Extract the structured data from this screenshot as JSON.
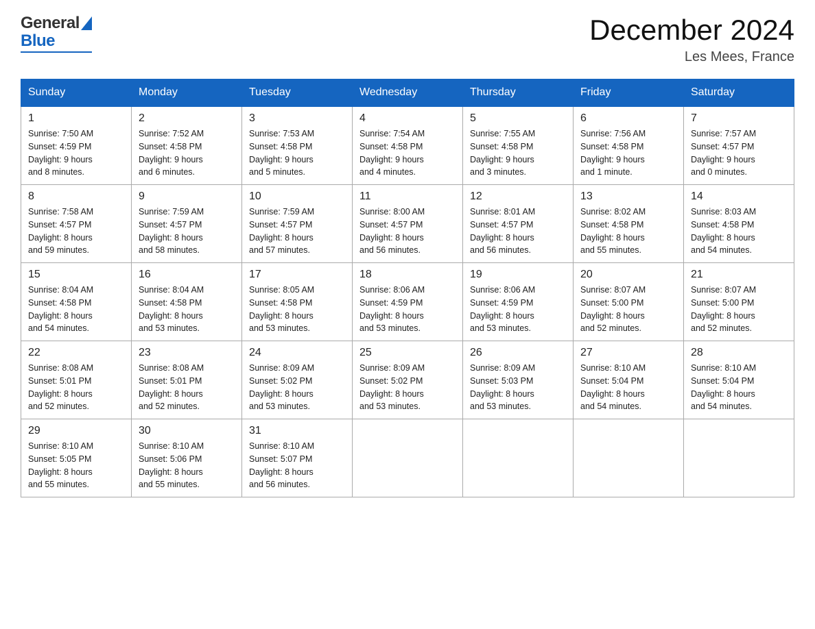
{
  "header": {
    "logo_general": "General",
    "logo_blue": "Blue",
    "title": "December 2024",
    "location": "Les Mees, France"
  },
  "columns": [
    "Sunday",
    "Monday",
    "Tuesday",
    "Wednesday",
    "Thursday",
    "Friday",
    "Saturday"
  ],
  "weeks": [
    [
      {
        "day": "1",
        "info": "Sunrise: 7:50 AM\nSunset: 4:59 PM\nDaylight: 9 hours\nand 8 minutes."
      },
      {
        "day": "2",
        "info": "Sunrise: 7:52 AM\nSunset: 4:58 PM\nDaylight: 9 hours\nand 6 minutes."
      },
      {
        "day": "3",
        "info": "Sunrise: 7:53 AM\nSunset: 4:58 PM\nDaylight: 9 hours\nand 5 minutes."
      },
      {
        "day": "4",
        "info": "Sunrise: 7:54 AM\nSunset: 4:58 PM\nDaylight: 9 hours\nand 4 minutes."
      },
      {
        "day": "5",
        "info": "Sunrise: 7:55 AM\nSunset: 4:58 PM\nDaylight: 9 hours\nand 3 minutes."
      },
      {
        "day": "6",
        "info": "Sunrise: 7:56 AM\nSunset: 4:58 PM\nDaylight: 9 hours\nand 1 minute."
      },
      {
        "day": "7",
        "info": "Sunrise: 7:57 AM\nSunset: 4:57 PM\nDaylight: 9 hours\nand 0 minutes."
      }
    ],
    [
      {
        "day": "8",
        "info": "Sunrise: 7:58 AM\nSunset: 4:57 PM\nDaylight: 8 hours\nand 59 minutes."
      },
      {
        "day": "9",
        "info": "Sunrise: 7:59 AM\nSunset: 4:57 PM\nDaylight: 8 hours\nand 58 minutes."
      },
      {
        "day": "10",
        "info": "Sunrise: 7:59 AM\nSunset: 4:57 PM\nDaylight: 8 hours\nand 57 minutes."
      },
      {
        "day": "11",
        "info": "Sunrise: 8:00 AM\nSunset: 4:57 PM\nDaylight: 8 hours\nand 56 minutes."
      },
      {
        "day": "12",
        "info": "Sunrise: 8:01 AM\nSunset: 4:57 PM\nDaylight: 8 hours\nand 56 minutes."
      },
      {
        "day": "13",
        "info": "Sunrise: 8:02 AM\nSunset: 4:58 PM\nDaylight: 8 hours\nand 55 minutes."
      },
      {
        "day": "14",
        "info": "Sunrise: 8:03 AM\nSunset: 4:58 PM\nDaylight: 8 hours\nand 54 minutes."
      }
    ],
    [
      {
        "day": "15",
        "info": "Sunrise: 8:04 AM\nSunset: 4:58 PM\nDaylight: 8 hours\nand 54 minutes."
      },
      {
        "day": "16",
        "info": "Sunrise: 8:04 AM\nSunset: 4:58 PM\nDaylight: 8 hours\nand 53 minutes."
      },
      {
        "day": "17",
        "info": "Sunrise: 8:05 AM\nSunset: 4:58 PM\nDaylight: 8 hours\nand 53 minutes."
      },
      {
        "day": "18",
        "info": "Sunrise: 8:06 AM\nSunset: 4:59 PM\nDaylight: 8 hours\nand 53 minutes."
      },
      {
        "day": "19",
        "info": "Sunrise: 8:06 AM\nSunset: 4:59 PM\nDaylight: 8 hours\nand 53 minutes."
      },
      {
        "day": "20",
        "info": "Sunrise: 8:07 AM\nSunset: 5:00 PM\nDaylight: 8 hours\nand 52 minutes."
      },
      {
        "day": "21",
        "info": "Sunrise: 8:07 AM\nSunset: 5:00 PM\nDaylight: 8 hours\nand 52 minutes."
      }
    ],
    [
      {
        "day": "22",
        "info": "Sunrise: 8:08 AM\nSunset: 5:01 PM\nDaylight: 8 hours\nand 52 minutes."
      },
      {
        "day": "23",
        "info": "Sunrise: 8:08 AM\nSunset: 5:01 PM\nDaylight: 8 hours\nand 52 minutes."
      },
      {
        "day": "24",
        "info": "Sunrise: 8:09 AM\nSunset: 5:02 PM\nDaylight: 8 hours\nand 53 minutes."
      },
      {
        "day": "25",
        "info": "Sunrise: 8:09 AM\nSunset: 5:02 PM\nDaylight: 8 hours\nand 53 minutes."
      },
      {
        "day": "26",
        "info": "Sunrise: 8:09 AM\nSunset: 5:03 PM\nDaylight: 8 hours\nand 53 minutes."
      },
      {
        "day": "27",
        "info": "Sunrise: 8:10 AM\nSunset: 5:04 PM\nDaylight: 8 hours\nand 54 minutes."
      },
      {
        "day": "28",
        "info": "Sunrise: 8:10 AM\nSunset: 5:04 PM\nDaylight: 8 hours\nand 54 minutes."
      }
    ],
    [
      {
        "day": "29",
        "info": "Sunrise: 8:10 AM\nSunset: 5:05 PM\nDaylight: 8 hours\nand 55 minutes."
      },
      {
        "day": "30",
        "info": "Sunrise: 8:10 AM\nSunset: 5:06 PM\nDaylight: 8 hours\nand 55 minutes."
      },
      {
        "day": "31",
        "info": "Sunrise: 8:10 AM\nSunset: 5:07 PM\nDaylight: 8 hours\nand 56 minutes."
      },
      {
        "day": "",
        "info": ""
      },
      {
        "day": "",
        "info": ""
      },
      {
        "day": "",
        "info": ""
      },
      {
        "day": "",
        "info": ""
      }
    ]
  ]
}
